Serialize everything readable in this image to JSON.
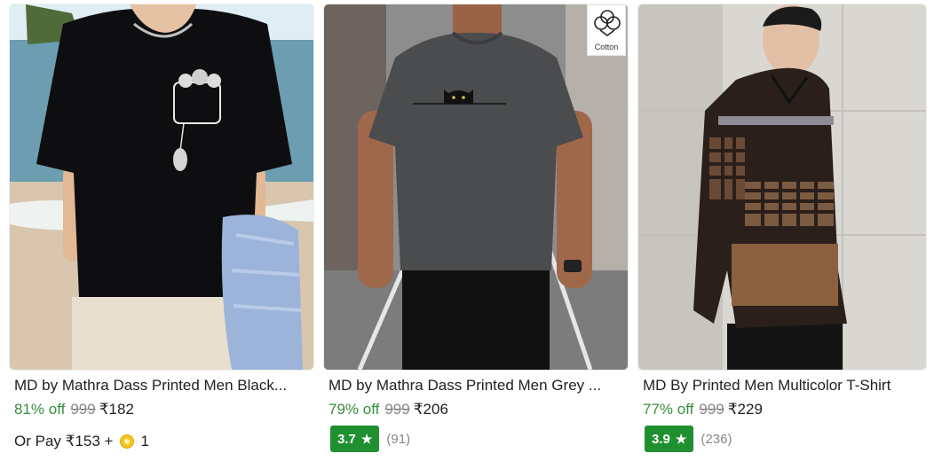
{
  "products": [
    {
      "title": "MD by Mathra Dass Printed Men Black...",
      "discount": "81% off",
      "mrp": "999",
      "price": "₹182",
      "or_pay_label": "Or Pay ₹153 +",
      "coins": "1"
    },
    {
      "title": "MD by Mathra Dass Printed Men Grey ...",
      "discount": "79% off",
      "mrp": "999",
      "price": "₹206",
      "rating": "3.7",
      "rating_count": "(91)",
      "badge_label": "Cotton"
    },
    {
      "title": "MD By Printed Men Multicolor T-Shirt",
      "discount": "77% off",
      "mrp": "999",
      "price": "₹229",
      "rating": "3.9",
      "rating_count": "(236)"
    }
  ],
  "colors": {
    "discount": "#388e3c",
    "rating_badge": "#1f8f2f",
    "muted": "#878787"
  }
}
